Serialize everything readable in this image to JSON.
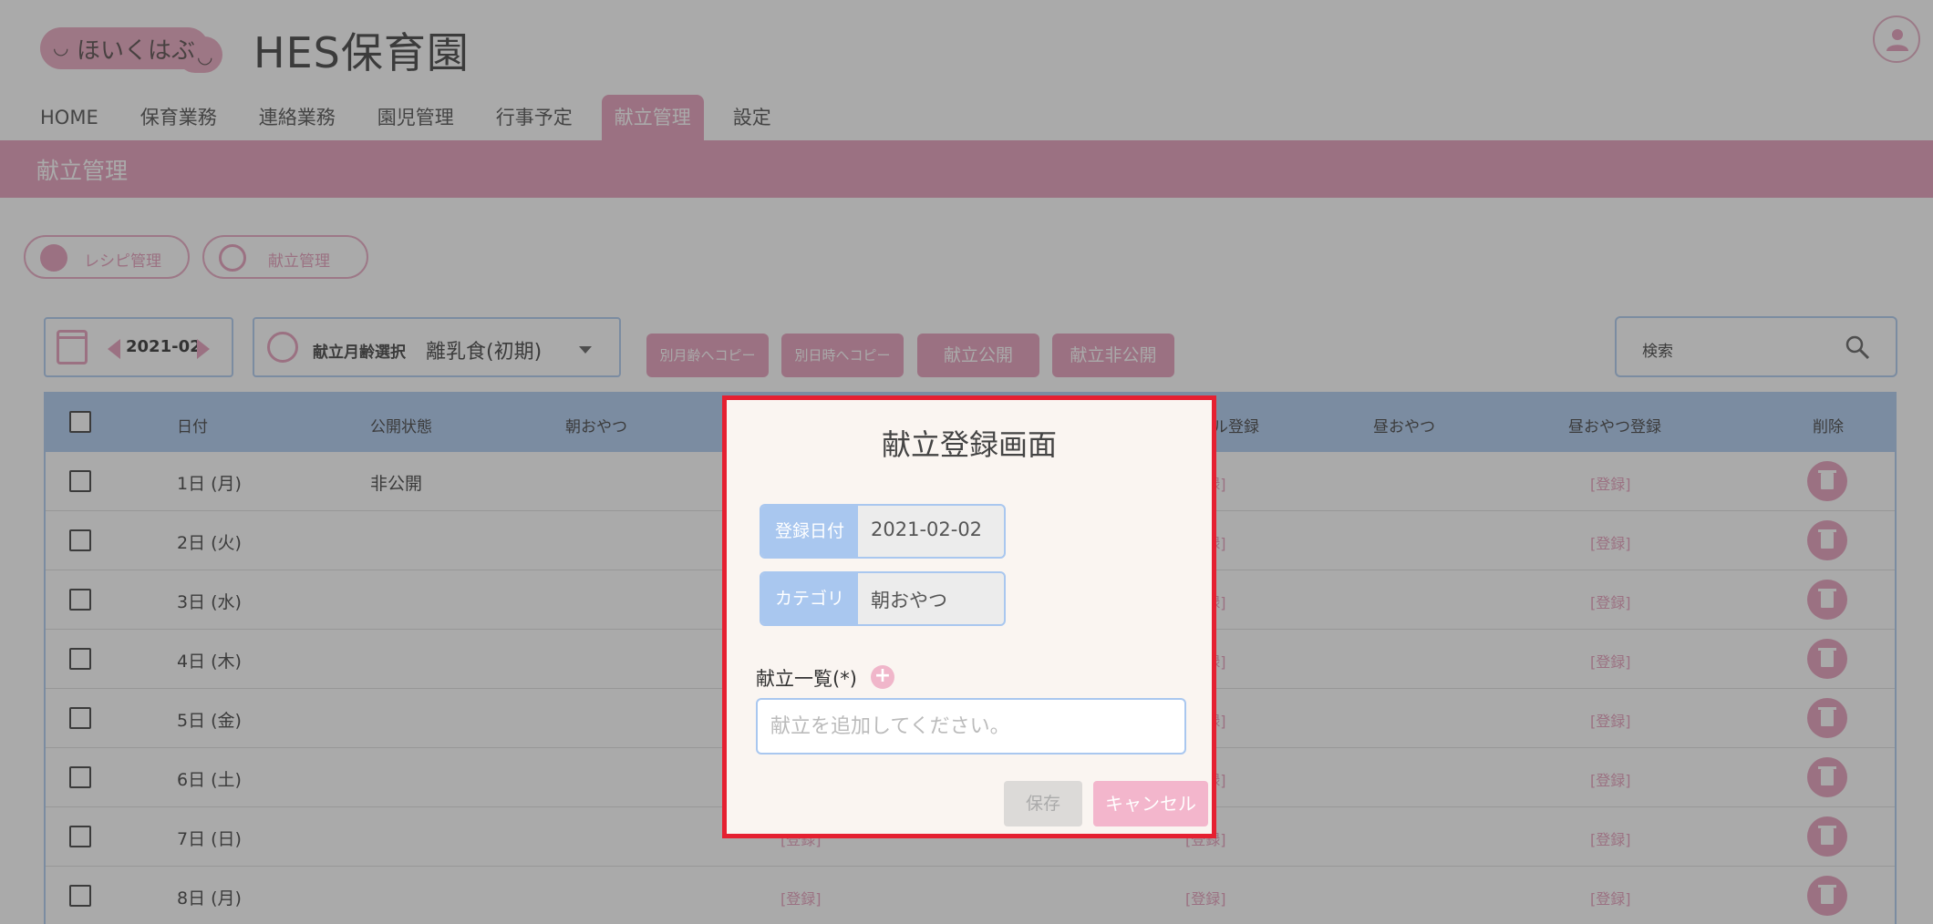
{
  "header": {
    "logo_text": "ほいくはぶ",
    "app_title": "HES保育園"
  },
  "nav": {
    "items": [
      "HOME",
      "保育業務",
      "連絡業務",
      "園児管理",
      "行事予定",
      "献立管理",
      "設定"
    ],
    "active": "献立管理"
  },
  "page": {
    "title": "献立管理"
  },
  "subnav": {
    "recipe_label": "レシピ管理",
    "menu_label": "献立管理"
  },
  "toolbar": {
    "month": "2021-02",
    "age_select_label": "献立月齢選択",
    "age_select_value": "離乳食(初期)",
    "copy_other_age": "別月齢へコピー",
    "copy_other_date": "別日時へコピー",
    "publish": "献立公開",
    "unpublish": "献立非公開",
    "search_label": "検索"
  },
  "table": {
    "headers": {
      "date": "日付",
      "status": "公開状態",
      "morning_snack": "朝おやつ",
      "lunch_register": "ル登録",
      "afternoon_snack": "昼おやつ",
      "afternoon_snack_register": "昼おやつ登録",
      "delete": "削除"
    },
    "register_label": "[登録]",
    "rows": [
      {
        "date": "1日 (月)",
        "status": "非公開"
      },
      {
        "date": "2日 (火)",
        "status": ""
      },
      {
        "date": "3日 (水)",
        "status": ""
      },
      {
        "date": "4日 (木)",
        "status": ""
      },
      {
        "date": "5日 (金)",
        "status": ""
      },
      {
        "date": "6日 (土)",
        "status": ""
      },
      {
        "date": "7日 (日)",
        "status": ""
      },
      {
        "date": "8日 (月)",
        "status": ""
      }
    ]
  },
  "modal": {
    "title": "献立登録画面",
    "date_label": "登録日付",
    "date_value": "2021-02-02",
    "category_label": "カテゴリ",
    "category_value": "朝おやつ",
    "list_label": "献立一覧(*)",
    "input_placeholder": "献立を追加してください。",
    "save": "保存",
    "cancel": "キャンセル"
  },
  "colors": {
    "accent_pink": "#e496b5",
    "accent_blue": "#a9c7ef",
    "highlight_red": "#e52031"
  }
}
